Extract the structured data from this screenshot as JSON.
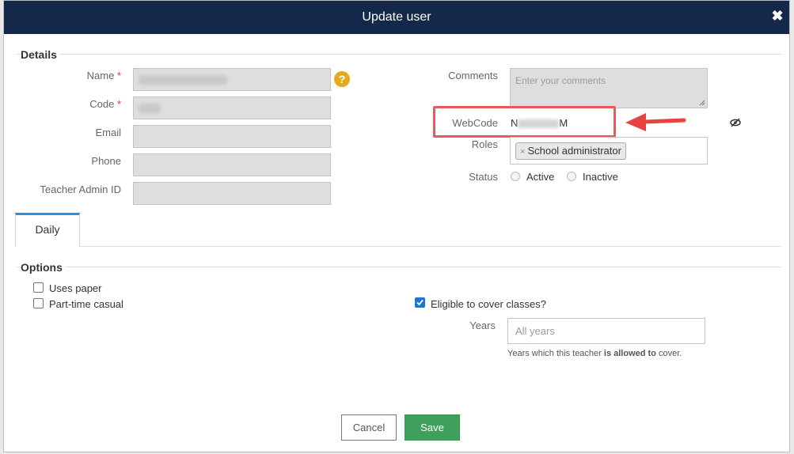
{
  "dialog": {
    "title": "Update user"
  },
  "details": {
    "legend": "Details",
    "name_label": "Name",
    "code_label": "Code",
    "required_mark": "*",
    "email_label": "Email",
    "phone_label": "Phone",
    "teacher_admin_id_label": "Teacher Admin ID",
    "help_glyph": "?",
    "comments_label": "Comments",
    "comments_placeholder": "Enter your comments",
    "webcode_label": "WebCode",
    "webcode_value": {
      "first": "N",
      "last": "M"
    },
    "roles_label": "Roles",
    "role_tag": {
      "remove": "×",
      "label": "School administrator"
    },
    "status_label": "Status",
    "status_options": [
      "Active",
      "Inactive"
    ]
  },
  "tabs": [
    {
      "label": "Daily"
    }
  ],
  "options": {
    "legend": "Options",
    "uses_paper": "Uses paper",
    "part_time_casual": "Part-time casual",
    "eligible_cover": "Eligible to cover classes?",
    "eligible_checked": true,
    "years_label": "Years",
    "years_placeholder": "All years",
    "years_help": {
      "prefix": "Years which this teacher ",
      "bold": "is allowed to",
      "suffix": " cover."
    }
  },
  "footer": {
    "cancel_label": "Cancel",
    "save_label": "Save"
  },
  "colors": {
    "header_bg": "#14284a",
    "highlight": "#e85a5a",
    "arrow": "#e8443f",
    "save_green": "#3ea05a",
    "tab_accent": "#2f8fd8",
    "help_orange": "#e8a81c"
  },
  "icons": {
    "close": "close-icon",
    "help": "help-icon",
    "eye": "eye-slash-icon",
    "arrow": "red-arrow-annotation"
  }
}
